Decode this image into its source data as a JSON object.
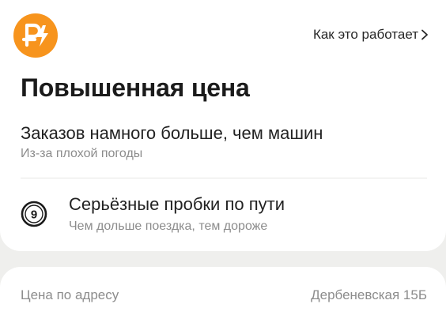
{
  "header": {
    "badge_icon": "ruble-lightning-icon",
    "badge_color": "#f7941d",
    "how_it_works_label": "Как это работает"
  },
  "main": {
    "title": "Повышенная цена",
    "reasons": [
      {
        "primary": "Заказов намного больше, чем машин",
        "secondary": "Из-за плохой погоды"
      },
      {
        "icon": "traffic-score-icon",
        "traffic_level": "9",
        "primary": "Серьёзные пробки по пути",
        "secondary": "Чем дольше поездка, тем дороже"
      }
    ]
  },
  "address": {
    "label": "Цена по адресу",
    "value": "Дербеневская 15Б"
  }
}
